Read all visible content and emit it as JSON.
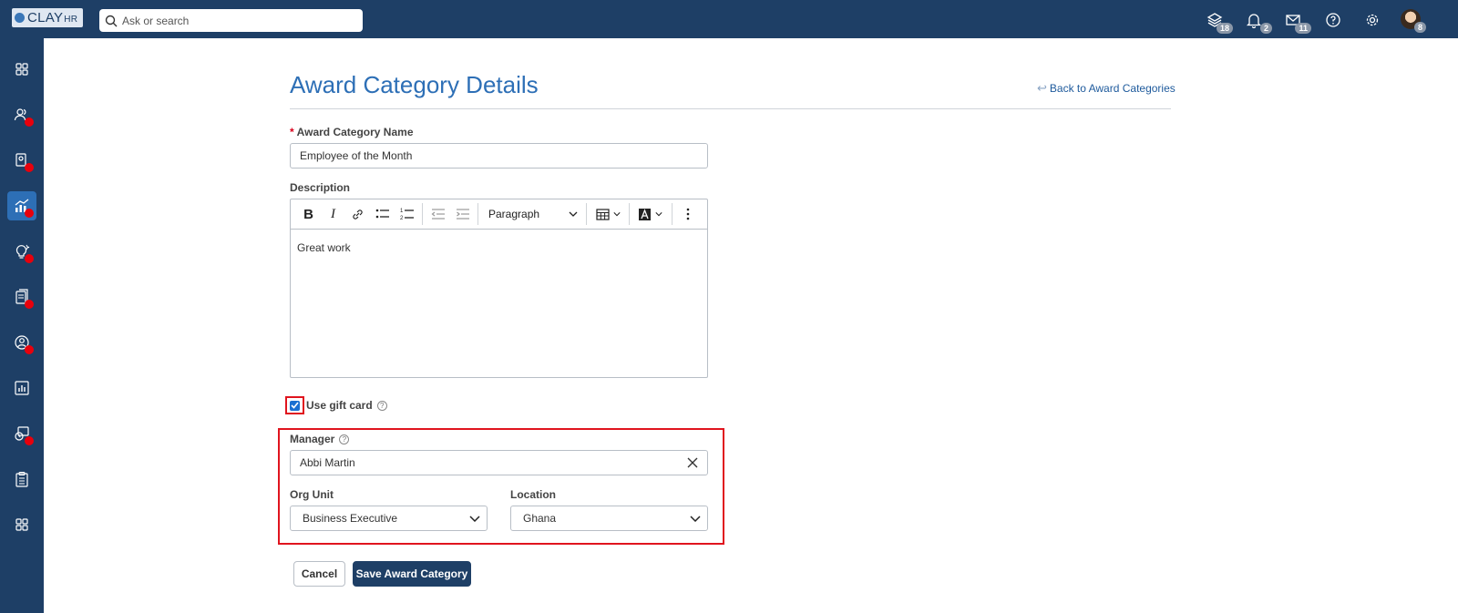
{
  "app": {
    "logo_text": "CLAY",
    "logo_suffix": "HR",
    "search_placeholder": "Ask or search"
  },
  "topbar": {
    "icons": [
      {
        "name": "layers-icon",
        "badge": "18"
      },
      {
        "name": "bell-icon",
        "badge": "2"
      },
      {
        "name": "mail-icon",
        "badge": "11"
      },
      {
        "name": "help-icon",
        "badge": ""
      },
      {
        "name": "gear-icon",
        "badge": ""
      }
    ],
    "avatar_badge": "8"
  },
  "sidebar": {
    "items": [
      {
        "name": "dashboard-icon",
        "alert": false,
        "active": false
      },
      {
        "name": "people-icon",
        "alert": true,
        "active": false
      },
      {
        "name": "employee-settings-icon",
        "alert": true,
        "active": false
      },
      {
        "name": "performance-icon",
        "alert": true,
        "active": true
      },
      {
        "name": "ideas-icon",
        "alert": true,
        "active": false
      },
      {
        "name": "documents-icon",
        "alert": true,
        "active": false
      },
      {
        "name": "profile-icon",
        "alert": true,
        "active": false
      },
      {
        "name": "reports-icon",
        "alert": false,
        "active": false
      },
      {
        "name": "time-clock-icon",
        "alert": true,
        "active": false
      },
      {
        "name": "clipboard-icon",
        "alert": false,
        "active": false
      },
      {
        "name": "apps-icon",
        "alert": false,
        "active": false
      }
    ]
  },
  "page": {
    "title": "Award Category Details",
    "back_link": "Back to Award Categories"
  },
  "form": {
    "name_label": "Award Category Name",
    "name_value": "Employee of the Month",
    "description_label": "Description",
    "editor": {
      "paragraph_select": "Paragraph",
      "content": "Great work"
    },
    "gift_card_label": "Use gift card",
    "gift_card_checked": true,
    "manager_label": "Manager",
    "manager_value": "Abbi Martin",
    "org_unit_label": "Org Unit",
    "org_unit_value": "Business Executive",
    "location_label": "Location",
    "location_value": "Ghana"
  },
  "actions": {
    "cancel": "Cancel",
    "save": "Save Award Category"
  },
  "colors": {
    "topbar": "#1e3f66",
    "accent": "#2d6fb6",
    "highlight": "#e0141e",
    "alert_dot": "#e8000c"
  }
}
